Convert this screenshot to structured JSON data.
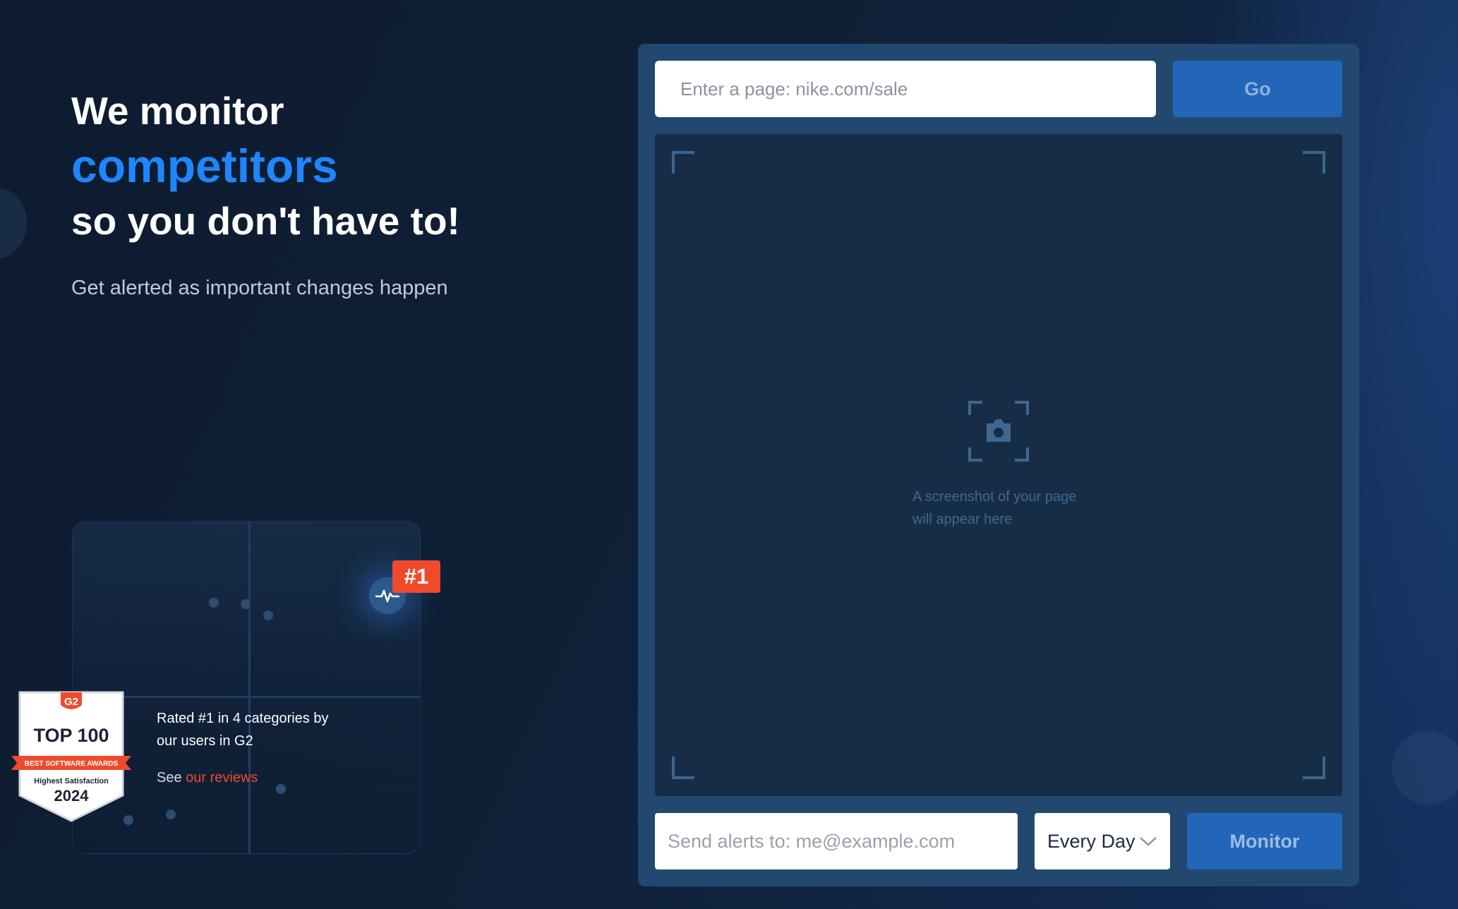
{
  "hero": {
    "title_line1": "We monitor",
    "title_line2": "competitors",
    "title_line3": "so you don't have to!",
    "subtitle": "Get alerted as important changes happen"
  },
  "g2": {
    "rank_badge": "#1",
    "award_brand": "G2",
    "award_title": "TOP 100",
    "award_ribbon": "BEST SOFTWARE AWARDS",
    "award_subtitle": "Highest Satisfaction",
    "award_year": "2024",
    "rating_text": "Rated #1 in 4 categories by our users in G2",
    "reviews_prefix": "See",
    "reviews_link": "our reviews"
  },
  "monitor_form": {
    "url_placeholder": "Enter a page: nike.com/sale",
    "go_label": "Go",
    "preview_message": "A screenshot of your page will appear here",
    "email_placeholder": "Send alerts to: me@example.com",
    "frequency_value": "Every Day",
    "monitor_label": "Monitor"
  },
  "icons": {
    "preview": "camera-icon",
    "pulse": "heartbeat-icon",
    "dropdown": "chevron-down-icon"
  },
  "colors": {
    "accent_blue": "#1f86ff",
    "button_blue": "#2166b8",
    "panel": "#22486f",
    "g2_red": "#f04a2d"
  }
}
